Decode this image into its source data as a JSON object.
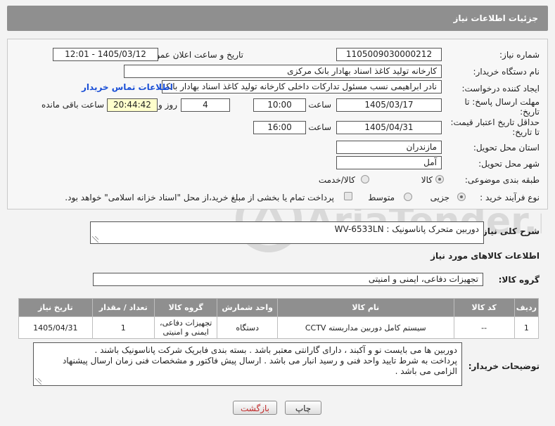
{
  "page_title": "جزئیات اطلاعات نیاز",
  "fields": {
    "need_number": {
      "label": "شماره نیاز:",
      "value": "1105009030000212"
    },
    "announce": {
      "label": "تاریخ و ساعت اعلان عمومی:",
      "value": "1405/03/12 - 12:01"
    },
    "buyer": {
      "label": "نام دستگاه خریدار:",
      "value": "کارخانه تولید کاغذ اسناد بهادار بانک مرکزی"
    },
    "creator": {
      "label": "ایجاد کننده درخواست:",
      "value": "نادر ابراهیمی نسب مسئول تدارکات داخلی کارخانه تولید کاغذ اسناد بهادار بانک مرکزی"
    },
    "contact_link": "اطلاعات تماس خریدار",
    "deadline": {
      "label_1": "مهلت ارسال پاسخ: تا",
      "label_2": "تاریخ:",
      "date": "1405/03/17",
      "time_label": "ساعت",
      "time": "10:00",
      "days": "4",
      "days_label": "روز و",
      "remaining": "20:44:42",
      "remaining_label": "ساعت باقی مانده"
    },
    "validity": {
      "label_1": "حداقل تاریخ اعتبار قیمت:",
      "label_2": "تا تاریخ:",
      "date": "1405/04/31",
      "time_label": "ساعت",
      "time": "16:00"
    },
    "province": {
      "label": "استان محل تحویل:",
      "value": "مازندران"
    },
    "city": {
      "label": "شهر محل تحویل:",
      "value": "آمل"
    },
    "category": {
      "label": "طبقه بندی موضوعی:",
      "opt1": "کالا",
      "opt2": "کالا/خدمت"
    },
    "process": {
      "label": "نوع فرآیند خرید :",
      "opt1": "جزیی",
      "opt2": "متوسط",
      "note": "پرداخت تمام یا بخشی از مبلغ خرید،از محل \"اسناد خزانه اسلامی\" خواهد بود."
    }
  },
  "summary": {
    "label": "شرح کلی نیاز:",
    "value": "دوربین متحرک پاناسونیک : WV-6533LN"
  },
  "goods_section_title": "اطلاعات کالاهای مورد نیاز",
  "goods_group": {
    "label": "گروه کالا:",
    "value": "تجهیزات دفاعی، ایمنی و امنیتی"
  },
  "table": {
    "headers": [
      "ردیف",
      "کد کالا",
      "نام کالا",
      "واحد شمارش",
      "گروه کالا",
      "تعداد / مقدار",
      "تاریخ نیاز"
    ],
    "rows": [
      {
        "idx": "1",
        "code": "--",
        "name": "سیستم کامل دوربین مداربسته CCTV",
        "unit": "دستگاه",
        "group": "تجهیزات دفاعی، ایمنی و امنیتی",
        "qty": "1",
        "date": "1405/04/31"
      }
    ]
  },
  "buyer_notes": {
    "label": "توضیحات خریدار:",
    "line1": "دوربین ها می بایست نو و آکبند ، دارای گارانتی معتبر باشد . بسته بندی فابریک شرکت پاناسونیک باشند .",
    "line2": "پرداخت به شرط تایید واحد فنی و رسید انبار می باشد . ارسال پیش فاکتور و مشخصات فنی زمان ارسال پیشنهاد الزامی می باشد ."
  },
  "buttons": {
    "print": "چاپ",
    "back": "بازگشت"
  },
  "watermark_text": "AriaTender.net",
  "colors": {
    "header": "#8f8f8f",
    "link": "#1a4fd6",
    "back_text": "#c02a2a",
    "highlight": "#ffffcc"
  }
}
